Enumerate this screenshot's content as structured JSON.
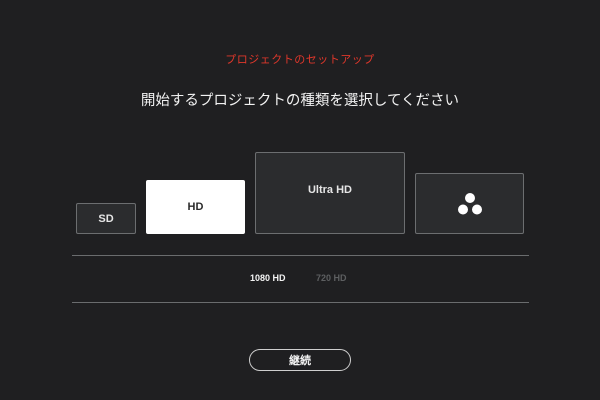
{
  "header": {
    "title": "プロジェクトのセットアップ",
    "subtitle": "開始するプロジェクトの種類を選択してください"
  },
  "cards": {
    "sd": {
      "label": "SD"
    },
    "hd": {
      "label": "HD",
      "selected": true
    },
    "uhd": {
      "label": "Ultra HD"
    },
    "custom": {
      "icon": "davinci-resolve-logo-icon"
    }
  },
  "resolutions": {
    "r1080": "1080 HD",
    "r720": "720 HD",
    "selected": "1080 HD"
  },
  "footer": {
    "continue_label": "継続"
  },
  "colors": {
    "background": "#1f1f21",
    "accent_title": "#e0372b",
    "card_bg": "#2b2c2e",
    "card_border": "#6c6e70",
    "selected_card": "#ffffff",
    "inactive_text": "#5d5f61"
  }
}
